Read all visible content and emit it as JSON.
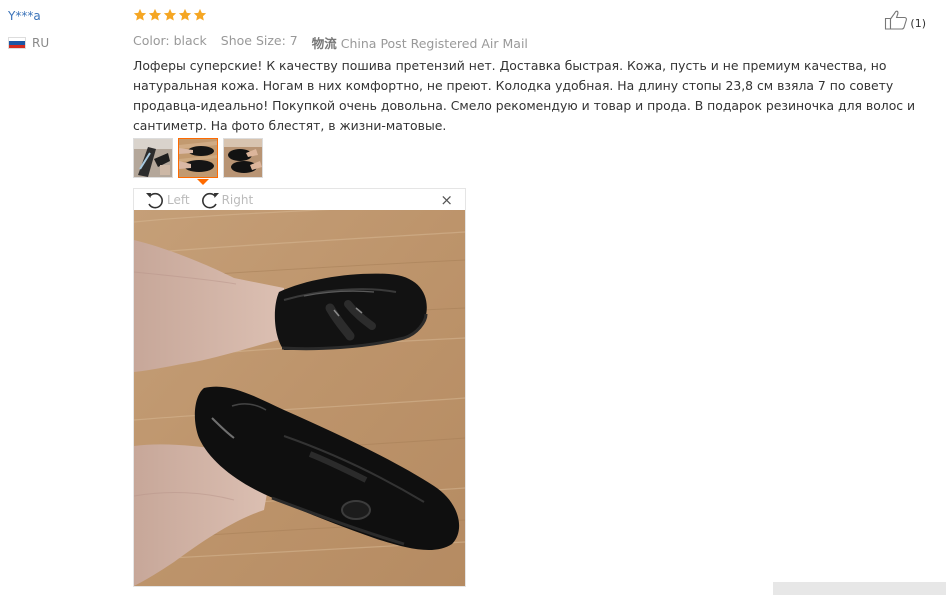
{
  "reviewer": {
    "name": "Y***a",
    "country_code": "RU",
    "flag_colors": [
      "#ffffff",
      "#1c57a5",
      "#d52b1e"
    ]
  },
  "rating": {
    "stars": 5,
    "max": 5,
    "star_color": "#f5a623"
  },
  "helpful": {
    "icon": "thumbs-up-icon",
    "count": "(1)"
  },
  "meta": {
    "color": "Color: black",
    "size": "Shoe Size: 7",
    "shipping_label": "物流",
    "shipping_method": "China Post Registered Air Mail"
  },
  "review": {
    "text": "Лоферы суперские! К качеству пошива претензий нет. Доставка быстрая. Кожа, пусть и не премиум качества, но натуральная кожа. Ногам в них комфортно, не преют. Колодка удобная. На длину стопы 23,8 см взяла 7 по совету продавца-идеально! Покупкой очень довольна. Смело рекомендую и товар и прода. В подарок резиночка для волос и сантиметр. На фото блестят, в жизни-матовые."
  },
  "photos": {
    "count": 3,
    "active_index": 1,
    "accent_color": "#ff6a00"
  },
  "viewer": {
    "rotate_left_label": "Left",
    "rotate_right_label": "Right",
    "close_label": "×"
  }
}
